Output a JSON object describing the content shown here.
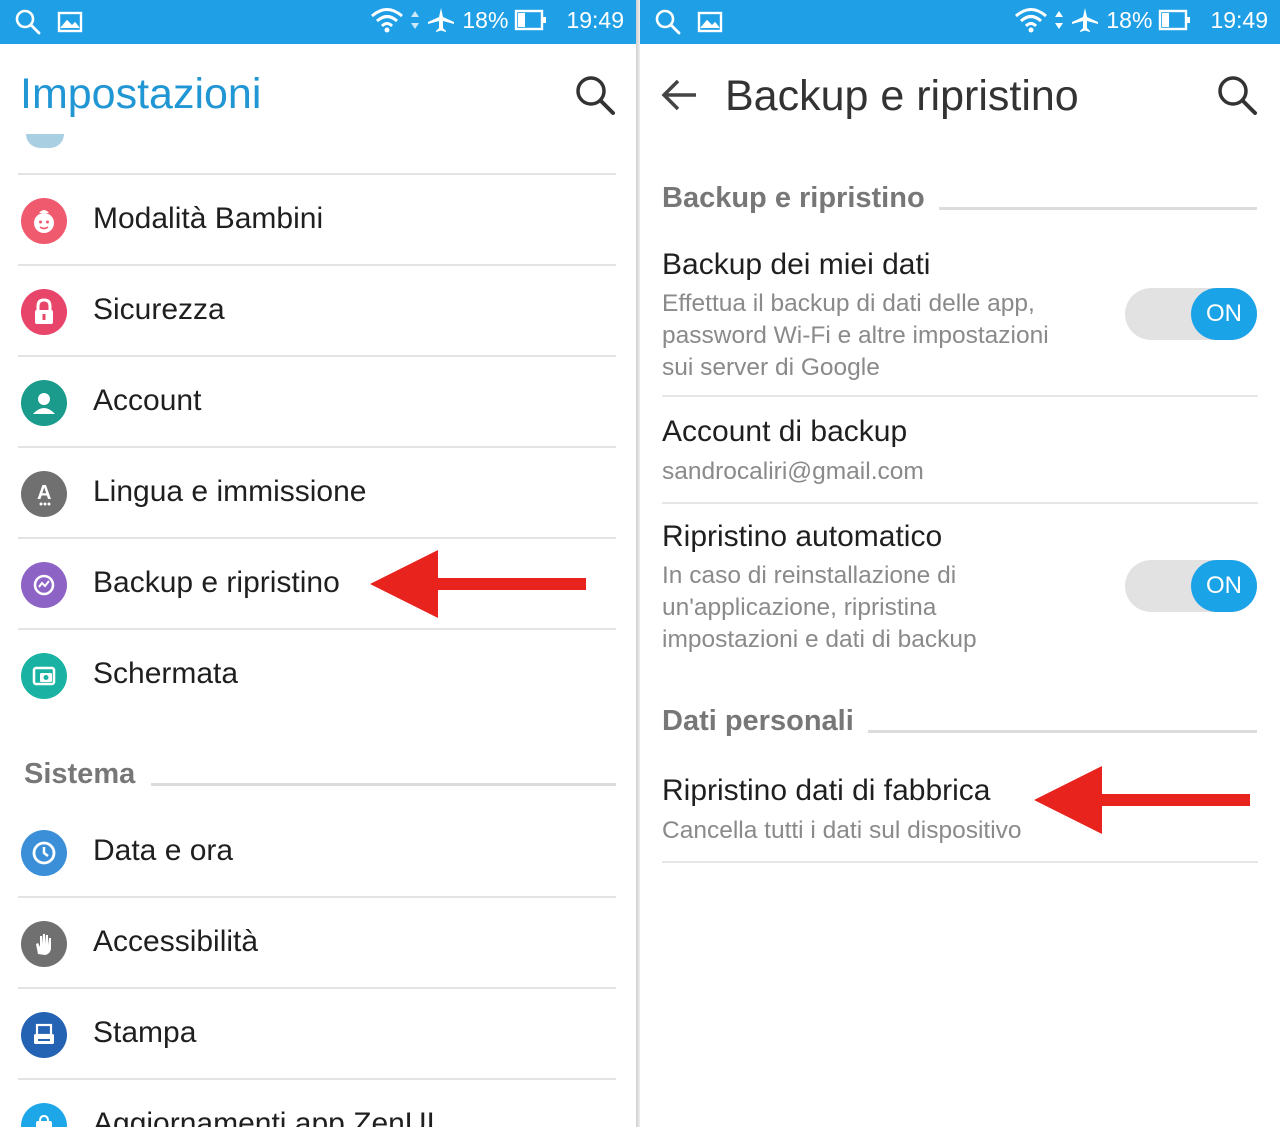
{
  "status_bar": {
    "battery": "18%",
    "time": "19:49"
  },
  "left": {
    "title": "Impostazioni",
    "items": [
      {
        "label": "Modalità Bambini",
        "icon": "kids-mode-icon",
        "color": "#f05a6e"
      },
      {
        "label": "Sicurezza",
        "icon": "lock-icon",
        "color": "#e8456a"
      },
      {
        "label": "Account",
        "icon": "account-icon",
        "color": "#1a9b8c"
      },
      {
        "label": "Lingua e immissione",
        "icon": "language-icon",
        "color": "#707070"
      },
      {
        "label": "Backup e ripristino",
        "icon": "backup-icon",
        "color": "#8e63c6"
      },
      {
        "label": "Schermata",
        "icon": "screenshot-icon",
        "color": "#1ab3a3"
      }
    ],
    "section_title": "Sistema",
    "system_items": [
      {
        "label": "Data e ora",
        "icon": "clock-icon",
        "color": "#3b8fd8"
      },
      {
        "label": "Accessibilità",
        "icon": "hand-icon",
        "color": "#707070"
      },
      {
        "label": "Stampa",
        "icon": "print-icon",
        "color": "#2463b3"
      },
      {
        "label": "Aggiornamenti app ZenUI",
        "icon": "update-icon",
        "color": "#1ea7e8"
      }
    ]
  },
  "right": {
    "title": "Backup e ripristino",
    "section1_title": "Backup e ripristino",
    "backup_data": {
      "title": "Backup dei miei dati",
      "subtitle_lines": [
        "Effettua il backup di dati delle app,",
        "password Wi-Fi e altre impostazioni",
        "sui server di Google"
      ],
      "toggle": "ON"
    },
    "backup_account": {
      "title": "Account di backup",
      "subtitle": "sandrocaliri@gmail.com"
    },
    "auto_restore": {
      "title": "Ripristino automatico",
      "subtitle_lines": [
        "In caso di reinstallazione di",
        "un'applicazione, ripristina",
        "impostazioni e dati di backup"
      ],
      "toggle": "ON"
    },
    "section2_title": "Dati personali",
    "factory_reset": {
      "title": "Ripristino dati di fabbrica",
      "subtitle": "Cancella tutti i dati sul dispositivo"
    }
  },
  "colors": {
    "status_bar": "#1e9fe6",
    "accent": "#2196d4",
    "toggle_on": "#1ba3e8",
    "arrow": "#e8231e"
  }
}
